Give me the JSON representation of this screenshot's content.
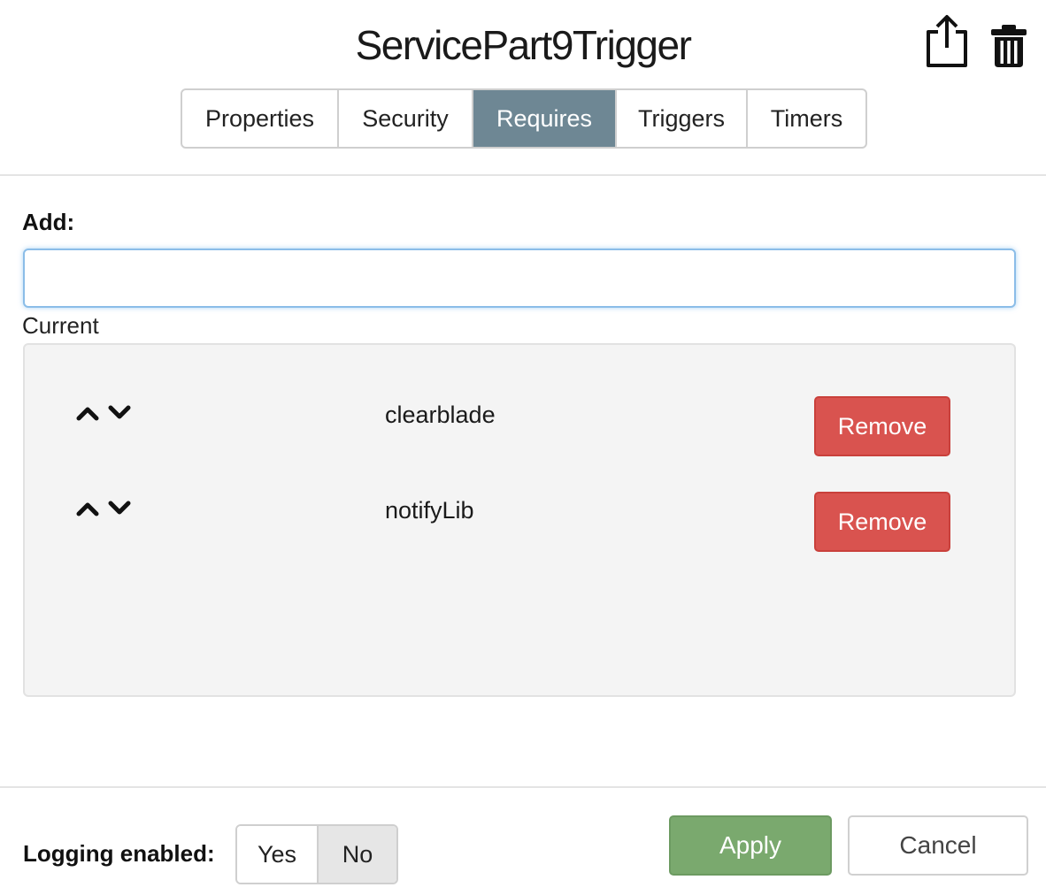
{
  "header": {
    "title": "ServicePart9Trigger",
    "icons": [
      "export-icon",
      "trash-icon"
    ]
  },
  "tabs": [
    {
      "label": "Properties",
      "active": false
    },
    {
      "label": "Security",
      "active": false
    },
    {
      "label": "Requires",
      "active": true
    },
    {
      "label": "Triggers",
      "active": false
    },
    {
      "label": "Timers",
      "active": false
    }
  ],
  "add": {
    "label": "Add:",
    "value": "",
    "placeholder": ""
  },
  "current": {
    "label": "Current",
    "items": [
      {
        "name": "clearblade",
        "remove_label": "Remove"
      },
      {
        "name": "notifyLib",
        "remove_label": "Remove"
      }
    ]
  },
  "footer": {
    "logging_label": "Logging enabled:",
    "logging_options": [
      "Yes",
      "No"
    ],
    "logging_selected": "No",
    "apply_label": "Apply",
    "cancel_label": "Cancel"
  },
  "colors": {
    "active_tab": "#6e8794",
    "remove": "#d9534f",
    "apply": "#7aa96e"
  }
}
